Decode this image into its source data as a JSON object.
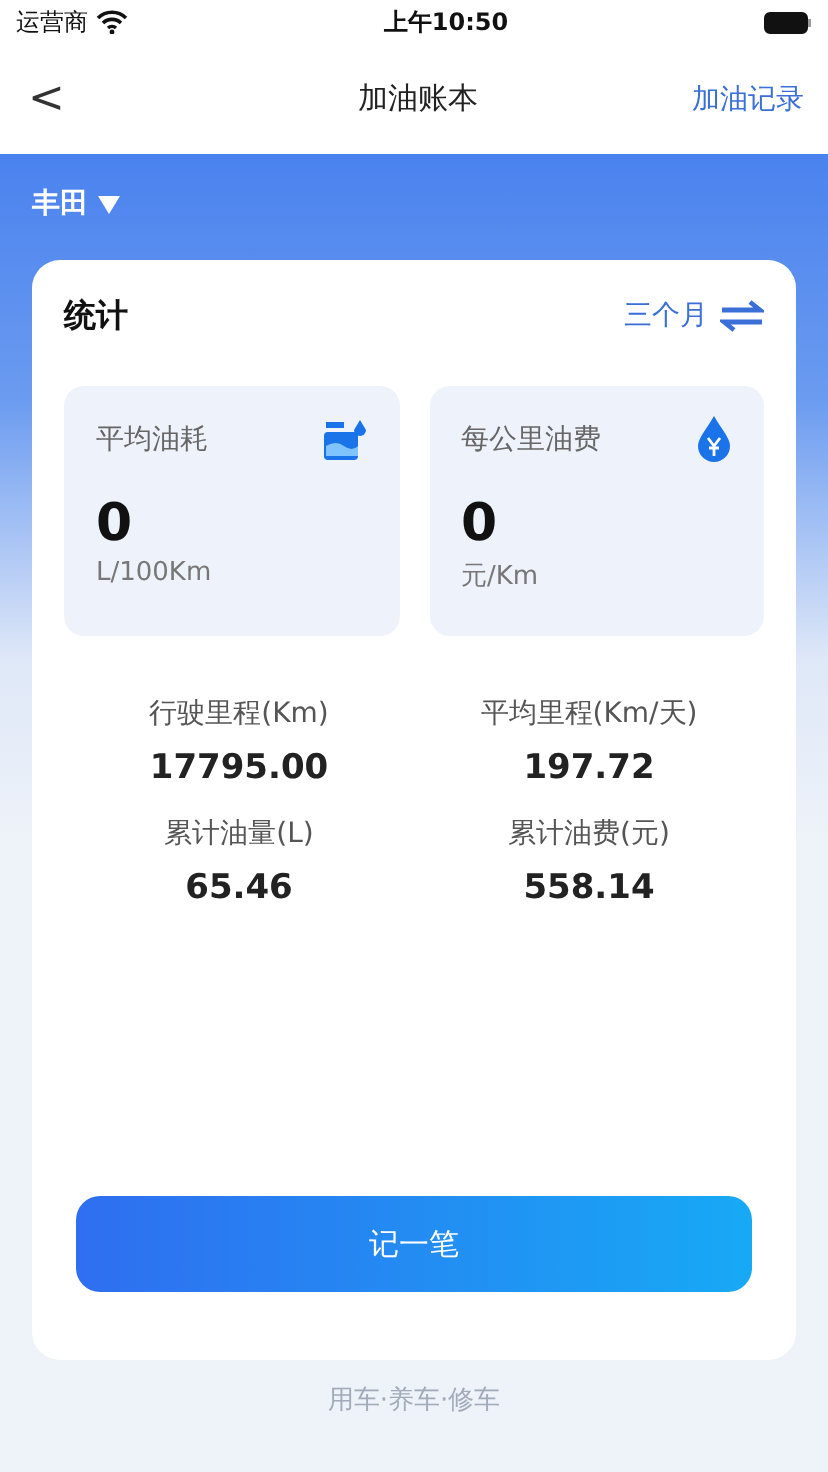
{
  "status_bar": {
    "carrier": "运营商",
    "time": "上午10:50"
  },
  "nav": {
    "back": "<",
    "title": "加油账本",
    "action": "加油记录"
  },
  "vehicle": {
    "name": "丰田"
  },
  "stats": {
    "title": "统计",
    "period": "三个月",
    "tiles": [
      {
        "kind": "consumption",
        "label": "平均油耗",
        "value": "0",
        "unit": "L/100Km"
      },
      {
        "kind": "cost",
        "label": "每公里油费",
        "value": "0",
        "unit": "元/Km"
      }
    ],
    "metrics": [
      {
        "label": "行驶里程(Km)",
        "value": "17795.00"
      },
      {
        "label": "平均里程(Km/天)",
        "value": "197.72"
      },
      {
        "label": "累计油量(L)",
        "value": "65.46"
      },
      {
        "label": "累计油费(元)",
        "value": "558.14"
      }
    ],
    "button": "记一笔"
  },
  "footer": "用车·养车·修车"
}
